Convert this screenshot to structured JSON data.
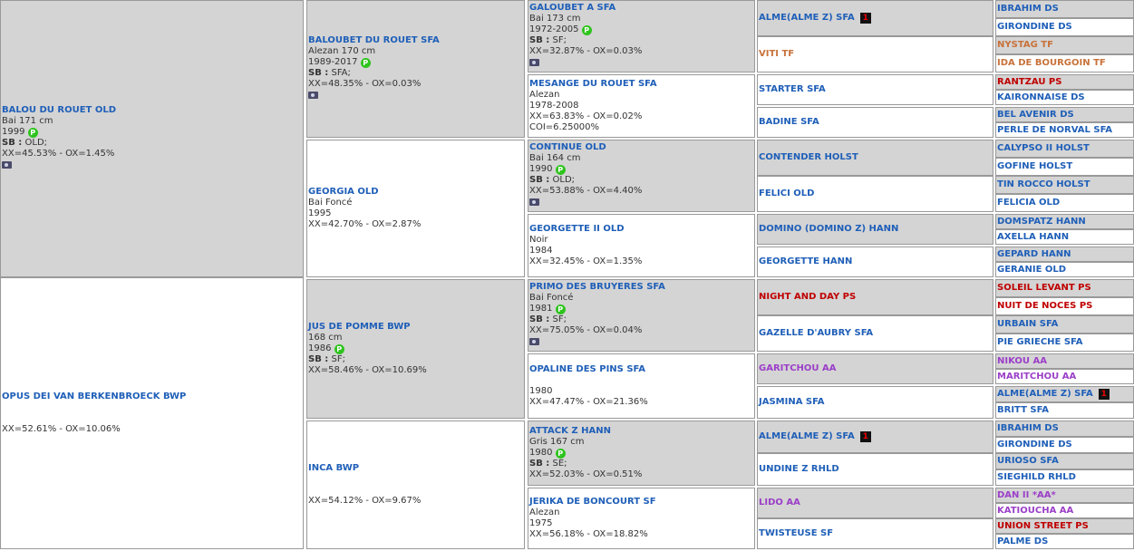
{
  "icons": {
    "chip": "P",
    "flag": "1"
  },
  "g1": [
    {
      "name": "BALOU DU ROUET OLD",
      "l1": "Bai  171 cm",
      "year": "1999",
      "sb": "OLD;",
      "xx": "XX=45.53% - OX=1.45%"
    },
    {
      "name": "OPUS DEI VAN BERKENBROECK BWP",
      "xx": "XX=52.61% - OX=10.06%"
    }
  ],
  "g2": [
    {
      "name": "BALOUBET DU ROUET SFA",
      "l1": "Alezan  170 cm",
      "year": "1989-2017",
      "sb": "SFA;",
      "xx": "XX=48.35% - OX=0.03%"
    },
    {
      "name": "GEORGIA OLD",
      "l1": "Bai Foncé",
      "year": "1995",
      "xx": "XX=42.70% - OX=2.87%"
    },
    {
      "name": "JUS DE POMME BWP",
      "l1": " 168 cm",
      "year": "1986",
      "sb": "SF;",
      "xx": "XX=58.46% - OX=10.69%"
    },
    {
      "name": "INCA BWP",
      "xx": "XX=54.12% - OX=9.67%"
    }
  ],
  "g3": [
    {
      "name": "GALOUBET A SFA",
      "l1": "Bai  173 cm",
      "year": "1972-2005",
      "sb": "SF;",
      "xx": "XX=32.87% - OX=0.03%"
    },
    {
      "name": "MESANGE DU ROUET SFA",
      "l1": "Alezan",
      "year": "1978-2008",
      "xx": "XX=63.83% - OX=0.02%",
      "coi": "COI=6.25000%"
    },
    {
      "name": "CONTINUE OLD",
      "l1": "Bai  164 cm",
      "year": "1990",
      "sb": "OLD;",
      "xx": "XX=53.88% - OX=4.40%"
    },
    {
      "name": "GEORGETTE II OLD",
      "l1": "Noir",
      "year": "1984",
      "xx": "XX=32.45% - OX=1.35%"
    },
    {
      "name": "PRIMO DES BRUYERES SFA",
      "l1": "Bai Foncé",
      "year": "1981",
      "sb": "SF;",
      "xx": "XX=75.05% - OX=0.04%"
    },
    {
      "name": "OPALINE DES PINS SFA",
      "l1": "",
      "year": "1980",
      "xx": "XX=47.47% - OX=21.36%"
    },
    {
      "name": "ATTACK Z HANN",
      "l1": "Gris  167 cm",
      "year": "1980",
      "sb": "SE;",
      "xx": "XX=52.03% - OX=0.51%"
    },
    {
      "name": "JERIKA DE BONCOURT SF",
      "l1": "Alezan",
      "year": "1975",
      "xx": "XX=56.18% - OX=18.82%"
    }
  ],
  "g4": [
    "ALME(ALME Z) SFA",
    "VITI TF",
    "STARTER SFA",
    "BADINE SFA",
    "CONTENDER HOLST",
    "FELICI OLD",
    "DOMINO (DOMINO Z) HANN",
    "GEORGETTE HANN",
    "NIGHT AND DAY PS",
    "GAZELLE D'AUBRY SFA",
    "GARITCHOU AA",
    "JASMINA SFA",
    "ALME(ALME Z) SFA",
    "UNDINE Z RHLD",
    "LIDO AA",
    "TWISTEUSE SF"
  ],
  "g5": [
    "IBRAHIM DS",
    "GIRONDINE DS",
    "NYSTAG TF",
    "IDA DE BOURGOIN TF",
    "RANTZAU PS",
    "KAIRONNAISE DS",
    "BEL AVENIR DS",
    "PERLE DE NORVAL SFA",
    "CALYPSO II HOLST",
    "GOFINE HOLST",
    "TIN ROCCO HOLST",
    "FELICIA OLD",
    "DOMSPATZ HANN",
    "AXELLA HANN",
    "GEPARD HANN",
    "GERANIE OLD",
    "SOLEIL LEVANT PS",
    "NUIT DE NOCES PS",
    "URBAIN SFA",
    "PIE GRIECHE SFA",
    "NIKOU AA",
    "MARITCHOU AA",
    "ALME(ALME Z) SFA",
    "BRITT SFA",
    "IBRAHIM DS",
    "GIRONDINE DS",
    "URIOSO SFA",
    "SIEGHILD RHLD",
    "DAN II *AA*",
    "KATIOUCHA AA",
    "UNION STREET PS",
    "PALME DS"
  ]
}
